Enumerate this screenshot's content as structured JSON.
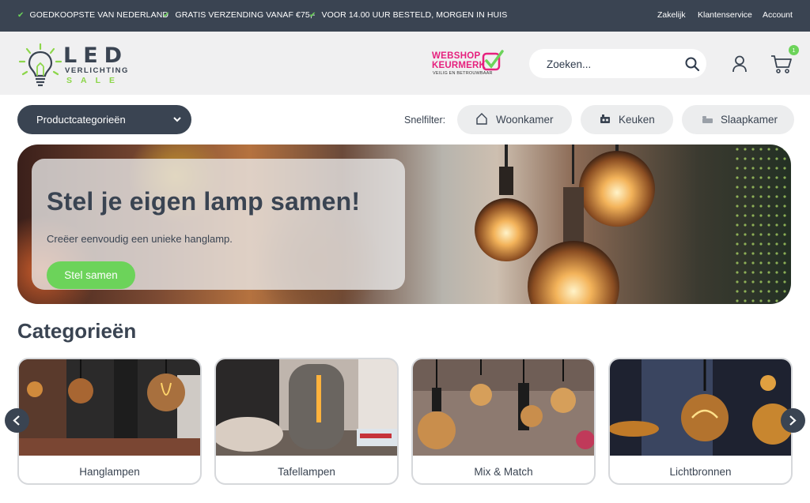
{
  "topbar": {
    "usps": [
      "GOEDKOOPSTE VAN NEDERLAND",
      "GRATIS VERZENDING VANAF €75,-",
      "VOOR 14.00 UUR BESTELD, MORGEN IN HUIS"
    ],
    "links": [
      "Zakelijk",
      "Klantenservice",
      "Account"
    ]
  },
  "logo": {
    "line1": "LED",
    "line2": "VERLICHTING",
    "line3": "SALE"
  },
  "keurmerk": {
    "line1": "WEBSHOP",
    "line2": "KEURMERK",
    "line3": "VEILIG EN BETROUWBAAR"
  },
  "search": {
    "placeholder": "Zoeken...",
    "value": ""
  },
  "cart": {
    "count": "1"
  },
  "filter": {
    "category_button": "Productcategorieën",
    "label": "Snelfilter:",
    "chips": [
      {
        "label": "Woonkamer",
        "icon": "house-icon"
      },
      {
        "label": "Keuken",
        "icon": "stove-icon"
      },
      {
        "label": "Slaapkamer",
        "icon": "bed-icon"
      }
    ]
  },
  "hero": {
    "title": "Stel je eigen lamp samen!",
    "subtitle": "Creëer eenvoudig een unieke hanglamp.",
    "cta": "Stel samen"
  },
  "categories": {
    "title": "Categorieën",
    "items": [
      "Hanglampen",
      "Tafellampen",
      "Mix & Match",
      "Lichtbronnen"
    ]
  },
  "colors": {
    "dark": "#3a4452",
    "accent": "#6cd35a",
    "keurmerk": "#e6217e"
  }
}
